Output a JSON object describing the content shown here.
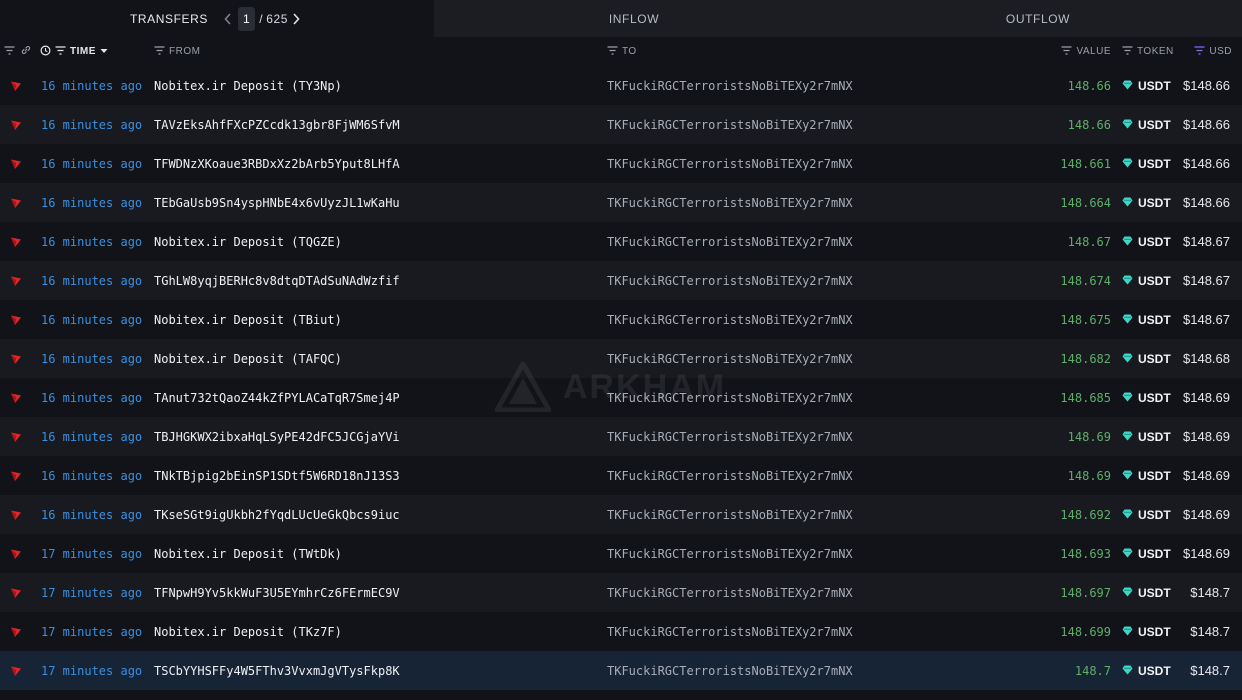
{
  "tabs": {
    "transfers": "TRANSFERS",
    "inflow": "INFLOW",
    "outflow": "OUTFLOW",
    "page_current": "1",
    "page_sep": "/",
    "page_total": "625"
  },
  "columns": {
    "time": "TIME",
    "from": "FROM",
    "to": "TO",
    "value": "VALUE",
    "token": "TOKEN",
    "usd": "USD"
  },
  "watermark": "ARKHAM",
  "colors": {
    "time_link": "#3b8fe0",
    "value_green": "#5fae6a",
    "tron_red": "#e0262a",
    "usdt_teal": "#3fd6c8"
  },
  "rows": [
    {
      "time": "16 minutes ago",
      "from": "Nobitex.ir Deposit (TY3Np)",
      "to": "TKFuckiRGCTerroristsNoBiTEXy2r7mNX",
      "value": "148.66",
      "token": "USDT",
      "usd": "$148.66"
    },
    {
      "time": "16 minutes ago",
      "from": "TAVzEksAhfFXcPZCcdk13gbr8FjWM6SfvM",
      "to": "TKFuckiRGCTerroristsNoBiTEXy2r7mNX",
      "value": "148.66",
      "token": "USDT",
      "usd": "$148.66"
    },
    {
      "time": "16 minutes ago",
      "from": "TFWDNzXKoaue3RBDxXz2bArb5Yput8LHfA",
      "to": "TKFuckiRGCTerroristsNoBiTEXy2r7mNX",
      "value": "148.661",
      "token": "USDT",
      "usd": "$148.66"
    },
    {
      "time": "16 minutes ago",
      "from": "TEbGaUsb9Sn4yspHNbE4x6vUyzJL1wKaHu",
      "to": "TKFuckiRGCTerroristsNoBiTEXy2r7mNX",
      "value": "148.664",
      "token": "USDT",
      "usd": "$148.66"
    },
    {
      "time": "16 minutes ago",
      "from": "Nobitex.ir Deposit (TQGZE)",
      "to": "TKFuckiRGCTerroristsNoBiTEXy2r7mNX",
      "value": "148.67",
      "token": "USDT",
      "usd": "$148.67"
    },
    {
      "time": "16 minutes ago",
      "from": "TGhLW8yqjBERHc8v8dtqDTAdSuNAdWzfif",
      "to": "TKFuckiRGCTerroristsNoBiTEXy2r7mNX",
      "value": "148.674",
      "token": "USDT",
      "usd": "$148.67"
    },
    {
      "time": "16 minutes ago",
      "from": "Nobitex.ir Deposit (TBiut)",
      "to": "TKFuckiRGCTerroristsNoBiTEXy2r7mNX",
      "value": "148.675",
      "token": "USDT",
      "usd": "$148.67"
    },
    {
      "time": "16 minutes ago",
      "from": "Nobitex.ir Deposit (TAFQC)",
      "to": "TKFuckiRGCTerroristsNoBiTEXy2r7mNX",
      "value": "148.682",
      "token": "USDT",
      "usd": "$148.68"
    },
    {
      "time": "16 minutes ago",
      "from": "TAnut732tQaoZ44kZfPYLACaTqR7Smej4P",
      "to": "TKFuckiRGCTerroristsNoBiTEXy2r7mNX",
      "value": "148.685",
      "token": "USDT",
      "usd": "$148.69"
    },
    {
      "time": "16 minutes ago",
      "from": "TBJHGKWX2ibxaHqLSyPE42dFC5JCGjaYVi",
      "to": "TKFuckiRGCTerroristsNoBiTEXy2r7mNX",
      "value": "148.69",
      "token": "USDT",
      "usd": "$148.69"
    },
    {
      "time": "16 minutes ago",
      "from": "TNkTBjpig2bEinSP1SDtf5W6RD18nJ13S3",
      "to": "TKFuckiRGCTerroristsNoBiTEXy2r7mNX",
      "value": "148.69",
      "token": "USDT",
      "usd": "$148.69"
    },
    {
      "time": "16 minutes ago",
      "from": "TKseSGt9igUkbh2fYqdLUcUeGkQbcs9iuc",
      "to": "TKFuckiRGCTerroristsNoBiTEXy2r7mNX",
      "value": "148.692",
      "token": "USDT",
      "usd": "$148.69"
    },
    {
      "time": "17 minutes ago",
      "from": "Nobitex.ir Deposit (TWtDk)",
      "to": "TKFuckiRGCTerroristsNoBiTEXy2r7mNX",
      "value": "148.693",
      "token": "USDT",
      "usd": "$148.69"
    },
    {
      "time": "17 minutes ago",
      "from": "TFNpwH9Yv5kkWuF3U5EYmhrCz6FErmEC9V",
      "to": "TKFuckiRGCTerroristsNoBiTEXy2r7mNX",
      "value": "148.697",
      "token": "USDT",
      "usd": "$148.7"
    },
    {
      "time": "17 minutes ago",
      "from": "Nobitex.ir Deposit (TKz7F)",
      "to": "TKFuckiRGCTerroristsNoBiTEXy2r7mNX",
      "value": "148.699",
      "token": "USDT",
      "usd": "$148.7"
    },
    {
      "time": "17 minutes ago",
      "from": "TSCbYYHSFFy4W5FThv3VvxmJgVTysFkp8K",
      "to": "TKFuckiRGCTerroristsNoBiTEXy2r7mNX",
      "value": "148.7",
      "token": "USDT",
      "usd": "$148.7"
    }
  ]
}
